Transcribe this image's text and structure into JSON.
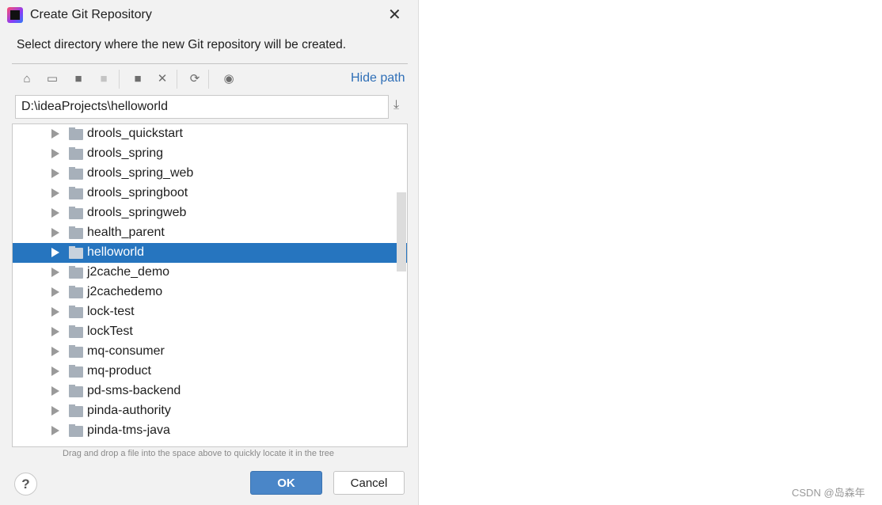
{
  "dialog": {
    "title": "Create Git Repository",
    "description": "Select directory where the new Git repository will be created.",
    "hide_path": "Hide path",
    "path_value": "D:\\ideaProjects\\helloworld",
    "hint": "Drag and drop a file into the space above to quickly locate it in the tree",
    "ok": "OK",
    "cancel": "Cancel",
    "help": "?"
  },
  "toolbar": [
    "home-icon",
    "desktop-icon",
    "project-folder-icon",
    "module-folder-icon",
    "new-folder-icon",
    "delete-icon",
    "refresh-icon",
    "show-hidden-icon"
  ],
  "tree": {
    "selected": "helloworld",
    "items": [
      "drools_quickstart",
      "drools_spring",
      "drools_spring_web",
      "drools_springboot",
      "drools_springweb",
      "health_parent",
      "helloworld",
      "j2cache_demo",
      "j2cachedemo",
      "lock-test",
      "lockTest",
      "mq-consumer",
      "mq-product",
      "pd-sms-backend",
      "pinda-authority",
      "pinda-tms-java"
    ]
  },
  "watermark": "CSDN @岛森年",
  "colors": {
    "selection": "#2675bf",
    "ok": "#4a86c8",
    "link": "#2f6fb7"
  }
}
